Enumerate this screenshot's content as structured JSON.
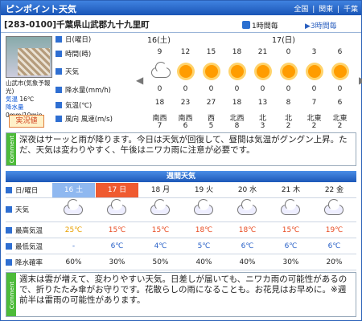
{
  "header": {
    "title": "ピンポイント天気",
    "nav": [
      "全国",
      "関東",
      "千葉"
    ]
  },
  "sub": {
    "location": "[283-0100]千葉県山武郡九十九里町",
    "tab1": "1時間毎",
    "tab3": "3時間毎"
  },
  "station": {
    "name": "山武市(気象予報光)",
    "temp_label": "気温",
    "temp": "16℃",
    "rain_label": "降水量",
    "rain": "0mm/10min",
    "tips": "実況値"
  },
  "row_labels": {
    "day": "日(曜日)",
    "time": "時間(時)",
    "weather": "天気",
    "precip": "降水量(mm/h)",
    "temp": "気温(℃)",
    "wind": "風向 風速(m/s)"
  },
  "hourly": {
    "day1": "16(土)",
    "day2": "17(日)",
    "times": [
      "9",
      "12",
      "15",
      "18",
      "21",
      "0",
      "3",
      "6"
    ],
    "precip": [
      "0",
      "0",
      "0",
      "0",
      "0",
      "0",
      "0",
      "0"
    ],
    "temp": [
      "18",
      "23",
      "27",
      "18",
      "13",
      "8",
      "7",
      "6"
    ],
    "wind_dir": [
      "南西",
      "南西",
      "西",
      "北西",
      "北",
      "北",
      "北東",
      "北東"
    ],
    "wind_speed": [
      "7",
      "6",
      "5",
      "8",
      "3",
      "2",
      "2",
      "2"
    ]
  },
  "comment1": "深夜はサーッと雨が降ります。今日は天気が回復して、昼間は気温がグングン上昇。ただ、天気は変わりやすく、午後はニワカ雨に注意が必要です。",
  "weekly": {
    "title": "週間天気",
    "days": [
      "16 土",
      "17 日",
      "18 月",
      "19 火",
      "20 水",
      "21 木",
      "22 金"
    ],
    "high": [
      "25℃",
      "15℃",
      "15℃",
      "18℃",
      "18℃",
      "15℃",
      "19℃"
    ],
    "low": [
      "-",
      "6℃",
      "4℃",
      "5℃",
      "6℃",
      "6℃",
      "6℃"
    ],
    "rain": [
      "60%",
      "30%",
      "50%",
      "40%",
      "40%",
      "30%",
      "20%"
    ],
    "labels": {
      "day": "日/曜日",
      "weather": "天気",
      "high": "最高気温",
      "low": "最低気温",
      "rain": "降水確率"
    }
  },
  "comment2": "週末は雲が増えて、変わりやすい天気。日差しが届いても、ニワカ雨の可能性があるので、折りたたみ傘がお守りです。花散らしの雨になることも。お花見はお早めに。※週前半は雷雨の可能性があります。",
  "comment_side": "Comment"
}
